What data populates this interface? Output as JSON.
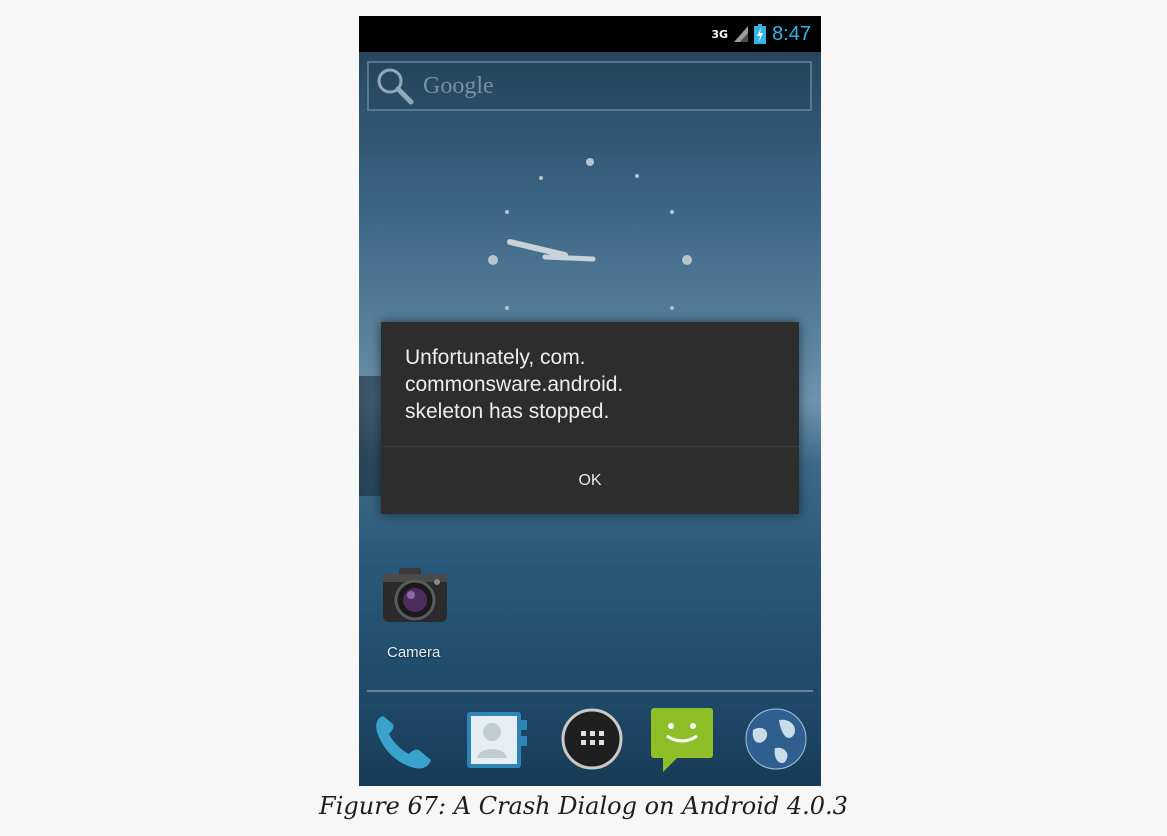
{
  "status_bar": {
    "network_type": "3G",
    "time": "8:47",
    "icons": [
      "signal-icon",
      "battery-charging-icon"
    ],
    "accent_color": "#33b5e5"
  },
  "search": {
    "label": "Google",
    "icon": "search-icon"
  },
  "home_clock": {
    "icon": "analog-clock-icon"
  },
  "dialog": {
    "message": "Unfortunately, com.\ncommonsware.android.\nskeleton has stopped.",
    "ok_label": "OK",
    "background_color": "#2d2d2d"
  },
  "desktop_apps": [
    {
      "label": "Camera",
      "icon": "camera-icon"
    }
  ],
  "dock": {
    "items": [
      {
        "icon": "phone-icon"
      },
      {
        "icon": "contacts-icon"
      },
      {
        "icon": "app-drawer-icon"
      },
      {
        "icon": "messaging-icon"
      },
      {
        "icon": "browser-globe-icon"
      }
    ]
  },
  "caption": "Figure 67: A Crash Dialog on Android 4.0.3"
}
